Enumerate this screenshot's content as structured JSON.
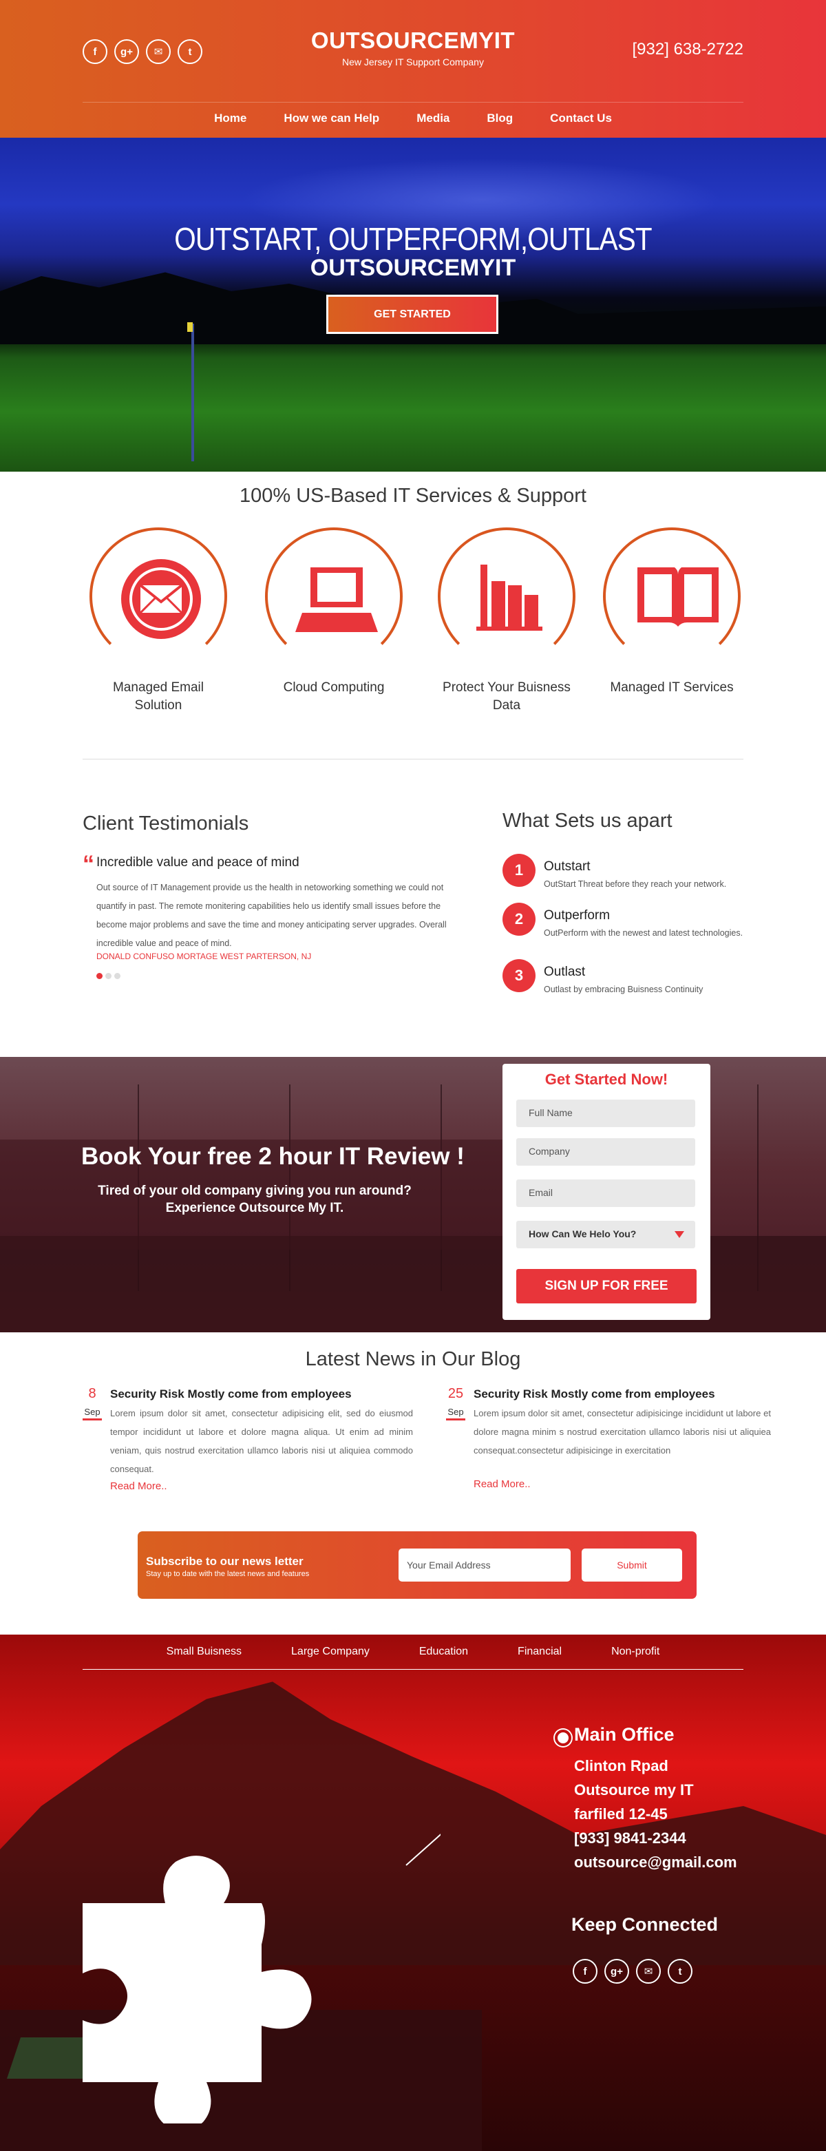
{
  "header": {
    "title": "OUTSOURCEMYIT",
    "subtitle": "New Jersey IT Support Company",
    "phone": "[932] 638-2722",
    "social": [
      "facebook-icon",
      "google-plus-icon",
      "email-icon",
      "twitter-icon"
    ],
    "social_glyphs": [
      "f",
      "g+",
      "✉",
      "t"
    ]
  },
  "nav": [
    "Home",
    "How we can Help",
    "Media",
    "Blog",
    "Contact Us"
  ],
  "hero": {
    "line1": "OUTSTART, OUTPERFORM,OUTLAST",
    "line2": "OUTSOURCEMYIT",
    "cta": "GET STARTED"
  },
  "services": {
    "title": "100% US-Based IT Services & Support",
    "items": [
      {
        "label": "Managed Email Solution",
        "icon": "email-icon"
      },
      {
        "label": "Cloud Computing",
        "icon": "laptop-icon"
      },
      {
        "label": "Protect Your Buisness Data",
        "icon": "bar-chart-icon"
      },
      {
        "label": "Managed IT Services",
        "icon": "book-icon"
      }
    ]
  },
  "testimonials": {
    "title": "Client Testimonials",
    "quote_title": "Incredible value and peace of mind",
    "body": "Out source of IT Management provide us the health in netoworking something we could not quantify in past. The remote monitering capabilities helo us identify small issues before the become major problems and save the time and money anticipating server upgrades. Overall incredible value and peace of mind.",
    "author": "DONALD CONFUSO MORTAGE WEST PARTERSON, NJ"
  },
  "apart": {
    "title": "What Sets us apart",
    "items": [
      {
        "num": "1",
        "title": "Outstart",
        "desc": "OutStart Threat before they reach your network."
      },
      {
        "num": "2",
        "title": "Outperform",
        "desc": "OutPerform with the newest and latest technologies."
      },
      {
        "num": "3",
        "title": "Outlast",
        "desc": "Outlast by embracing Buisness  Continuity"
      }
    ]
  },
  "review": {
    "title": "Book Your free 2 hour IT Review !",
    "subtitle": "Tired of your old company giving you run around? Experience Outsource My IT.",
    "form": {
      "title": "Get Started Now!",
      "full_name": "Full Name",
      "company": "Company",
      "email": "Email",
      "select": "How Can We Helo You?",
      "submit": "SIGN UP FOR FREE"
    }
  },
  "news": {
    "title": "Latest News in Our Blog",
    "posts": [
      {
        "day": "8",
        "month": "Sep",
        "title": "Security Risk Mostly come from employees",
        "body": "Lorem ipsum dolor sit amet, consectetur adipisicing elit, sed do eiusmod tempor incididunt ut labore et dolore magna aliqua. Ut enim ad minim veniam, quis nostrud exercitation ullamco laboris nisi ut aliquiea commodo consequat.",
        "more": "Read More.."
      },
      {
        "day": "25",
        "month": "Sep",
        "title": "Security Risk Mostly come from employees",
        "body": "Lorem ipsum dolor sit amet, consectetur adipisicinge incididunt ut labore et dolore magna minim s nostrud exercitation ullamco laboris nisi ut aliquiea   consequat.consectetur adipisicinge in exercitation",
        "more": "Read More.."
      }
    ]
  },
  "subscribe": {
    "title": "Subscribe to our news letter",
    "subtitle": "Stay up to date with the latest news and features",
    "placeholder": "Your Email Address",
    "button": "Submit"
  },
  "footer": {
    "nav": [
      "Small Buisness",
      "Large Company",
      "Education",
      "Financial",
      "Non-profit"
    ],
    "office_title": "Main Office",
    "office_lines": [
      "Clinton Rpad",
      "Outsource my IT",
      "farfiled 12-45",
      "[933] 9841-2344",
      "outsource@gmail.com"
    ],
    "keep_title": "Keep Connected"
  }
}
